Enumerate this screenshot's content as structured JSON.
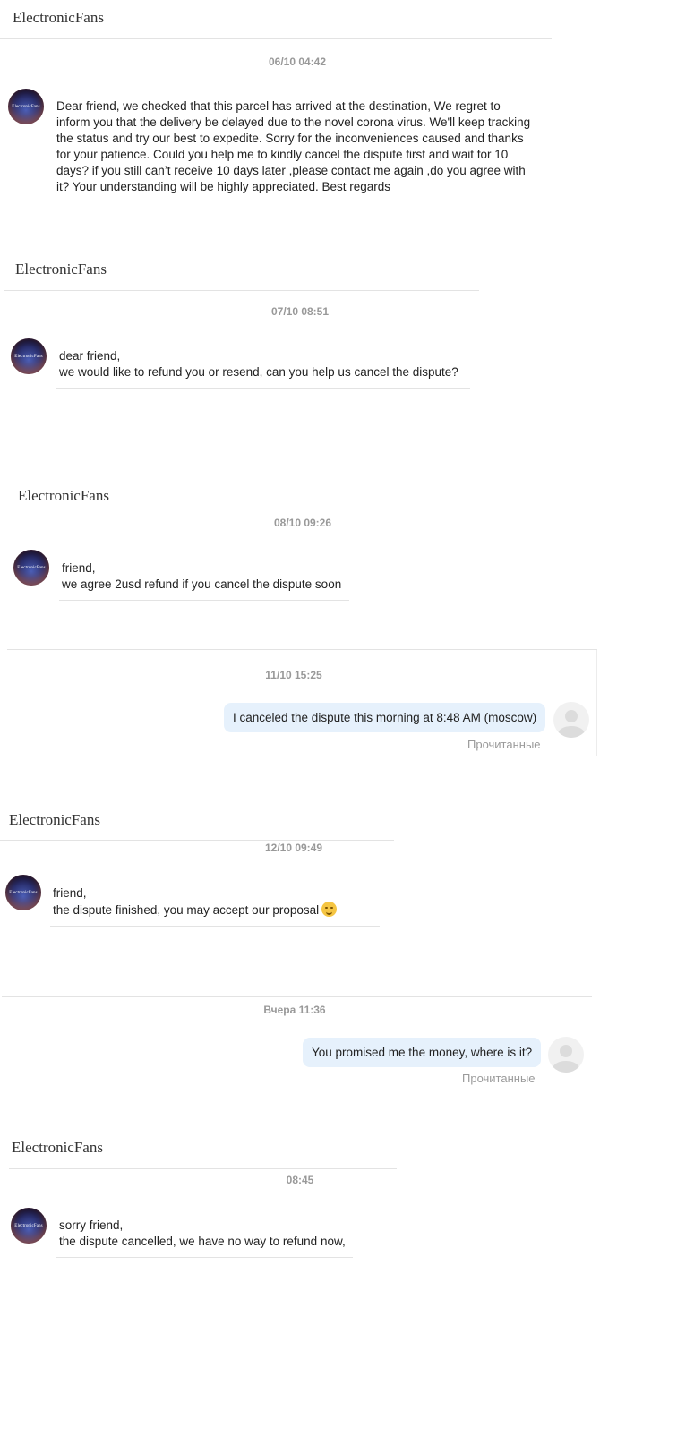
{
  "seller": "ElectronicFans",
  "avatar_text": "ElectronicFans",
  "read_label": "Прочитанные",
  "messages": [
    {
      "time": "06/10 04:42",
      "lines": [
        "Dear friend, we checked that this parcel has arrived at the destination,   We regret to",
        "inform you that the delivery be delayed due to the novel corona virus. We'll keep tracking",
        "the status and try our best to expedite. Sorry for the inconveniences caused and thanks",
        "for your patience. Could you help me to kindly cancel the dispute first and wait for 10",
        "days? if you still can’t receive 10 days later ,please contact me again ,do you agree with",
        "it? Your understanding will be highly appreciated. Best regards"
      ]
    },
    {
      "time": "07/10 08:51",
      "lines": [
        "dear friend,",
        "we would like to refund you or resend, can you help us cancel the dispute?"
      ]
    },
    {
      "time": "08/10 09:26",
      "lines": [
        "friend,",
        "we agree 2usd refund if you cancel the dispute soon"
      ]
    },
    {
      "time": "11/10 15:25",
      "text": "I canceled the dispute this morning at 8:48 AM (moscow)"
    },
    {
      "time": "12/10 09:49",
      "lines": [
        "friend,",
        "the dispute finished, you may accept our proposal"
      ]
    },
    {
      "time": "Вчера 11:36",
      "text": "You promised me the money, where is it?"
    },
    {
      "time": "08:45",
      "lines": [
        "sorry friend,",
        "the dispute cancelled, we have no way to refund now,"
      ]
    }
  ]
}
